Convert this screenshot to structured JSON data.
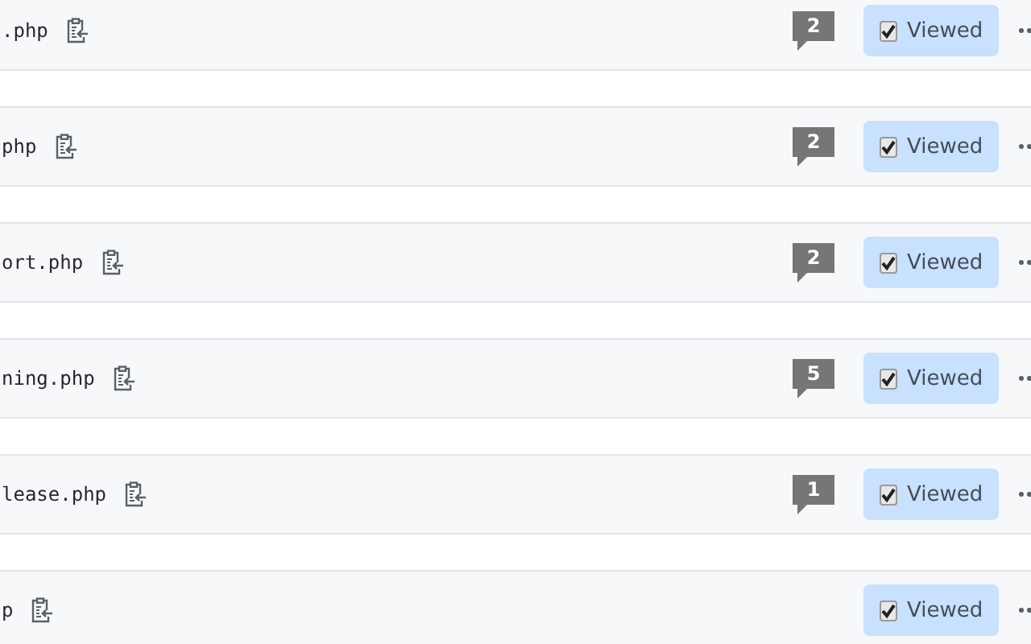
{
  "files": [
    {
      "name": ".php",
      "comments": "2",
      "viewed": true,
      "viewed_label": "Viewed"
    },
    {
      "name": "php",
      "comments": "2",
      "viewed": true,
      "viewed_label": "Viewed"
    },
    {
      "name": "ort.php",
      "comments": "2",
      "viewed": true,
      "viewed_label": "Viewed"
    },
    {
      "name": "ning.php",
      "comments": "5",
      "viewed": true,
      "viewed_label": "Viewed"
    },
    {
      "name": "lease.php",
      "comments": "1",
      "viewed": true,
      "viewed_label": "Viewed"
    },
    {
      "name": "p",
      "viewed": true,
      "viewed_label": "Viewed"
    }
  ]
}
